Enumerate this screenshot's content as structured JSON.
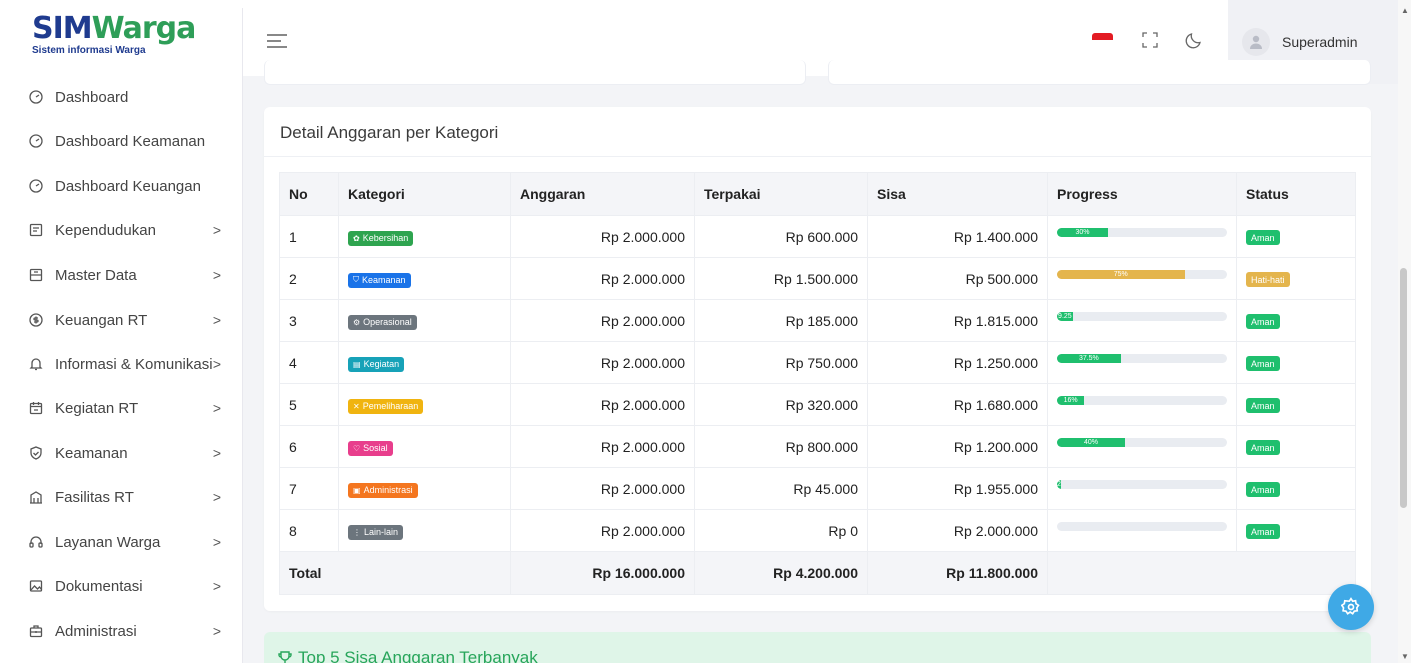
{
  "logo": {
    "main_a": "SIM",
    "main_b": "Warga",
    "sub": "Sistem informasi Warga"
  },
  "sidebar": {
    "items": [
      {
        "label": "Dashboard",
        "icon": "gauge-icon",
        "has_children": false
      },
      {
        "label": "Dashboard Keamanan",
        "icon": "gauge-icon",
        "has_children": false
      },
      {
        "label": "Dashboard Keuangan",
        "icon": "gauge-icon",
        "has_children": false
      },
      {
        "label": "Kependudukan",
        "icon": "id-card-icon",
        "has_children": true
      },
      {
        "label": "Master Data",
        "icon": "database-icon",
        "has_children": true
      },
      {
        "label": "Keuangan RT",
        "icon": "dollar-circle-icon",
        "has_children": true
      },
      {
        "label": "Informasi & Komunikasi",
        "icon": "bell-icon",
        "has_children": true
      },
      {
        "label": "Kegiatan RT",
        "icon": "calendar-icon",
        "has_children": true
      },
      {
        "label": "Keamanan",
        "icon": "shield-icon",
        "has_children": true
      },
      {
        "label": "Fasilitas RT",
        "icon": "building-icon",
        "has_children": true
      },
      {
        "label": "Layanan Warga",
        "icon": "headset-icon",
        "has_children": true
      },
      {
        "label": "Dokumentasi",
        "icon": "image-icon",
        "has_children": true
      },
      {
        "label": "Administrasi",
        "icon": "briefcase-icon",
        "has_children": true
      }
    ],
    "chevron": ">"
  },
  "header": {
    "user_name": "Superadmin"
  },
  "card": {
    "title": "Detail Anggaran per Kategori",
    "columns": [
      "No",
      "Kategori",
      "Anggaran",
      "Terpakai",
      "Sisa",
      "Progress",
      "Status"
    ],
    "rows": [
      {
        "no": "1",
        "kategori": "Kebersihan",
        "icon": "✿",
        "badge_color": "#2ea44f",
        "anggaran": "Rp 2.000.000",
        "terpakai": "Rp 600.000",
        "sisa": "Rp 1.400.000",
        "progress": 30,
        "progress_label": "30%",
        "progress_color": "#1fbf6e",
        "status": "Aman",
        "status_color": "#1fbf6e"
      },
      {
        "no": "2",
        "kategori": "Keamanan",
        "icon": "⛉",
        "badge_color": "#1a73e8",
        "anggaran": "Rp 2.000.000",
        "terpakai": "Rp 1.500.000",
        "sisa": "Rp 500.000",
        "progress": 75,
        "progress_label": "75%",
        "progress_color": "#e4b54d",
        "status": "Hati-hati",
        "status_color": "#e4b54d"
      },
      {
        "no": "3",
        "kategori": "Operasional",
        "icon": "⚙",
        "badge_color": "#6c757d",
        "anggaran": "Rp 2.000.000",
        "terpakai": "Rp 185.000",
        "sisa": "Rp 1.815.000",
        "progress": 9.25,
        "progress_label": "9.25",
        "progress_color": "#1fbf6e",
        "status": "Aman",
        "status_color": "#1fbf6e"
      },
      {
        "no": "4",
        "kategori": "Kegiatan",
        "icon": "▤",
        "badge_color": "#17a2b8",
        "anggaran": "Rp 2.000.000",
        "terpakai": "Rp 750.000",
        "sisa": "Rp 1.250.000",
        "progress": 37.5,
        "progress_label": "37.5%",
        "progress_color": "#1fbf6e",
        "status": "Aman",
        "status_color": "#1fbf6e"
      },
      {
        "no": "5",
        "kategori": "Pemeliharaan",
        "icon": "✕",
        "badge_color": "#f0b410",
        "anggaran": "Rp 2.000.000",
        "terpakai": "Rp 320.000",
        "sisa": "Rp 1.680.000",
        "progress": 16,
        "progress_label": "16%",
        "progress_color": "#1fbf6e",
        "status": "Aman",
        "status_color": "#1fbf6e"
      },
      {
        "no": "6",
        "kategori": "Sosial",
        "icon": "♡",
        "badge_color": "#e83e8c",
        "anggaran": "Rp 2.000.000",
        "terpakai": "Rp 800.000",
        "sisa": "Rp 1.200.000",
        "progress": 40,
        "progress_label": "40%",
        "progress_color": "#1fbf6e",
        "status": "Aman",
        "status_color": "#1fbf6e"
      },
      {
        "no": "7",
        "kategori": "Administrasi",
        "icon": "▣",
        "badge_color": "#f4761f",
        "anggaran": "Rp 2.000.000",
        "terpakai": "Rp 45.000",
        "sisa": "Rp 1.955.000",
        "progress": 2.25,
        "progress_label": "2",
        "progress_color": "#1fbf6e",
        "status": "Aman",
        "status_color": "#1fbf6e"
      },
      {
        "no": "8",
        "kategori": "Lain-lain",
        "icon": "⋮",
        "badge_color": "#6c757d",
        "anggaran": "Rp 2.000.000",
        "terpakai": "Rp 0",
        "sisa": "Rp 2.000.000",
        "progress": 0,
        "progress_label": "",
        "progress_color": "#1fbf6e",
        "status": "Aman",
        "status_color": "#1fbf6e"
      }
    ],
    "total": {
      "label": "Total",
      "anggaran": "Rp 16.000.000",
      "terpakai": "Rp 4.200.000",
      "sisa": "Rp 11.800.000"
    }
  },
  "card2": {
    "title": "Top 5 Sisa Anggaran Terbanyak"
  },
  "colors": {
    "primary": "#1f3b8f",
    "accent_green": "#2e9e58",
    "fab": "#3fa9e6"
  }
}
